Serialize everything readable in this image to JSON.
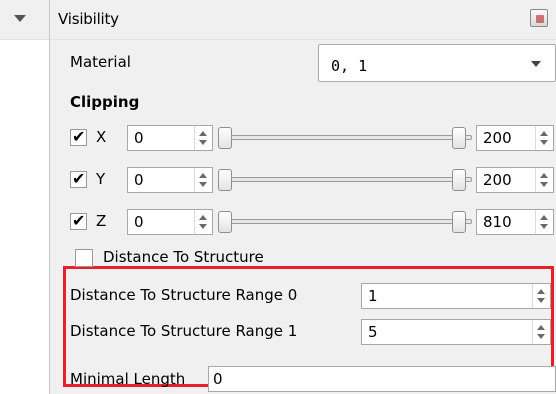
{
  "section": {
    "title": "Visibility"
  },
  "material": {
    "label": "Material",
    "value": "0, 1"
  },
  "clipping": {
    "heading": "Clipping",
    "rows": [
      {
        "axis": "X",
        "checked": "✔",
        "min": "0",
        "max": "200"
      },
      {
        "axis": "Y",
        "checked": "✔",
        "min": "0",
        "max": "200"
      },
      {
        "axis": "Z",
        "checked": "✔",
        "min": "0",
        "max": "810"
      }
    ]
  },
  "distance": {
    "checkbox_label": "Distance To Structure",
    "range0_label": "Distance To Structure Range 0",
    "range0_value": "1",
    "range1_label": "Distance To Structure Range 1",
    "range1_value": "5"
  },
  "minimal_length": {
    "label": "Minimal Length",
    "value": "0"
  },
  "colors": {
    "highlight": "#e8202a",
    "panel": "#f0f0f0"
  }
}
